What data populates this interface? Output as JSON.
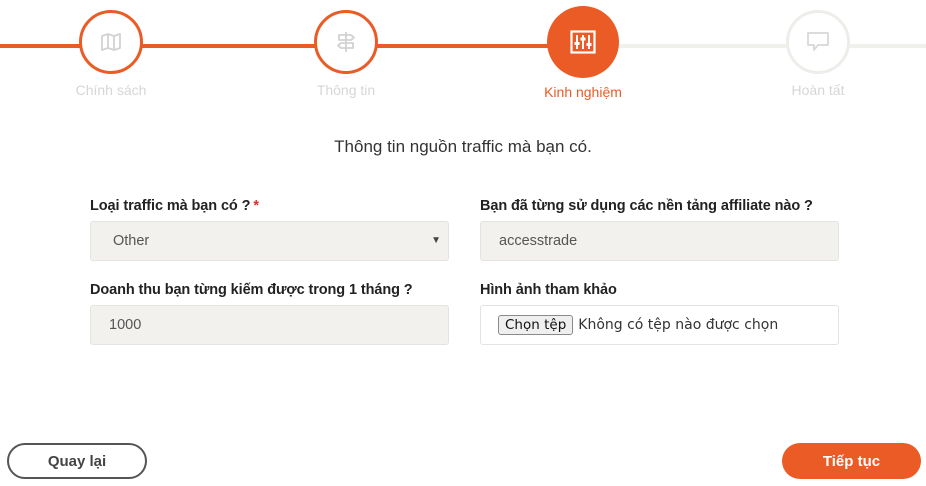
{
  "steps": [
    {
      "label": "Chính sách",
      "icon": "map-icon",
      "state": "done"
    },
    {
      "label": "Thông tin",
      "icon": "signpost-icon",
      "state": "done"
    },
    {
      "label": "Kinh nghiệm",
      "icon": "sliders-icon",
      "state": "active"
    },
    {
      "label": "Hoàn tất",
      "icon": "chat-icon",
      "state": "todo"
    }
  ],
  "colors": {
    "accent": "#ea5b25",
    "track_inactive": "#f1f1ec",
    "field_bg": "#f2f1ee"
  },
  "form": {
    "subtitle": "Thông tin nguồn traffic mà bạn có.",
    "traffic_type": {
      "label": "Loại traffic mà bạn có ?",
      "required_mark": "*",
      "value": "Other"
    },
    "platforms": {
      "label": "Bạn đã từng sử dụng các nền tảng affiliate nào ?",
      "value": "accesstrade"
    },
    "revenue": {
      "label": "Doanh thu bạn từng kiếm được trong 1 tháng ?",
      "value": "1000"
    },
    "reference_image": {
      "label": "Hình ảnh tham khảo",
      "button_label": "Chọn tệp",
      "status": "Không có tệp nào được chọn"
    }
  },
  "actions": {
    "back_label": "Quay lại",
    "next_label": "Tiếp tục"
  }
}
